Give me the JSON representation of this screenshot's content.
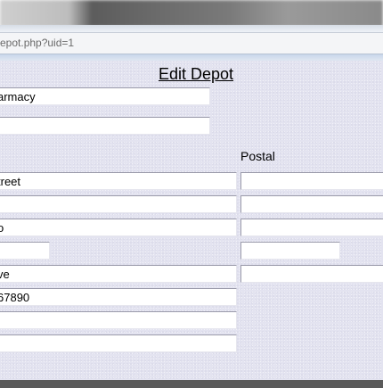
{
  "browser": {
    "address_text": "epot.php?uid=1"
  },
  "form": {
    "title": "Edit Depot",
    "postal_label": "Postal",
    "left_fields": [
      {
        "value": "armacy"
      },
      {
        "value": ""
      },
      {
        "value": "treet"
      },
      {
        "value": ""
      },
      {
        "value": "o"
      },
      {
        "value": ""
      },
      {
        "value": "ve"
      },
      {
        "value": "67890"
      },
      {
        "value": ""
      },
      {
        "value": ""
      }
    ],
    "postal_fields": [
      {
        "value": ""
      },
      {
        "value": ""
      },
      {
        "value": ""
      },
      {
        "value": ""
      },
      {
        "value": ""
      }
    ]
  }
}
